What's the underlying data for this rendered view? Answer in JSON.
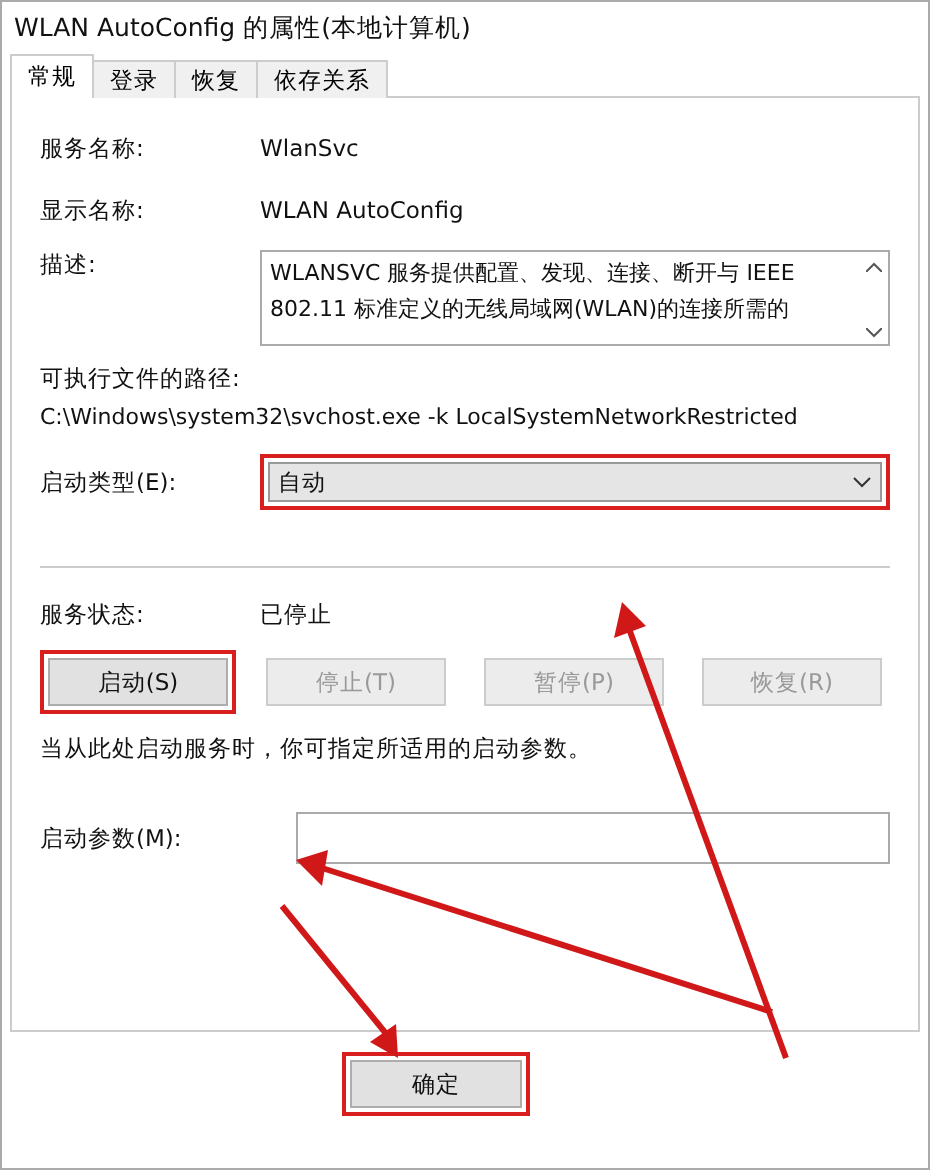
{
  "window": {
    "title": "WLAN AutoConfig 的属性(本地计算机)"
  },
  "tabs": [
    {
      "label": "常规",
      "selected": true
    },
    {
      "label": "登录",
      "selected": false
    },
    {
      "label": "恢复",
      "selected": false
    },
    {
      "label": "依存关系",
      "selected": false
    }
  ],
  "service_name": {
    "label": "服务名称:",
    "value": "WlanSvc"
  },
  "display_name": {
    "label": "显示名称:",
    "value": "WLAN AutoConfig"
  },
  "description": {
    "label": "描述:",
    "value": "WLANSVC 服务提供配置、发现、连接、断开与 IEEE 802.11 标准定义的无线局域网(WLAN)的连接所需的"
  },
  "executable_path": {
    "label": "可执行文件的路径:",
    "value": "C:\\Windows\\system32\\svchost.exe -k LocalSystemNetworkRestricted"
  },
  "startup_type": {
    "label": "启动类型(E):",
    "value": "自动",
    "highlighted": true
  },
  "service_status": {
    "label": "服务状态:",
    "value": "已停止"
  },
  "service_buttons": [
    {
      "label": "启动(S)",
      "disabled": false,
      "highlighted": true
    },
    {
      "label": "停止(T)",
      "disabled": true,
      "highlighted": false
    },
    {
      "label": "暂停(P)",
      "disabled": true,
      "highlighted": false
    },
    {
      "label": "恢复(R)",
      "disabled": true,
      "highlighted": false
    }
  ],
  "hint": "当从此处启动服务时，你可指定所适用的启动参数。",
  "start_parameters": {
    "label": "启动参数(M):"
  },
  "dialog_buttons": [
    {
      "label": "确定",
      "highlighted": true
    }
  ],
  "arrows": [
    {
      "kind": "up"
    },
    {
      "kind": "left"
    },
    {
      "kind": "down"
    }
  ]
}
